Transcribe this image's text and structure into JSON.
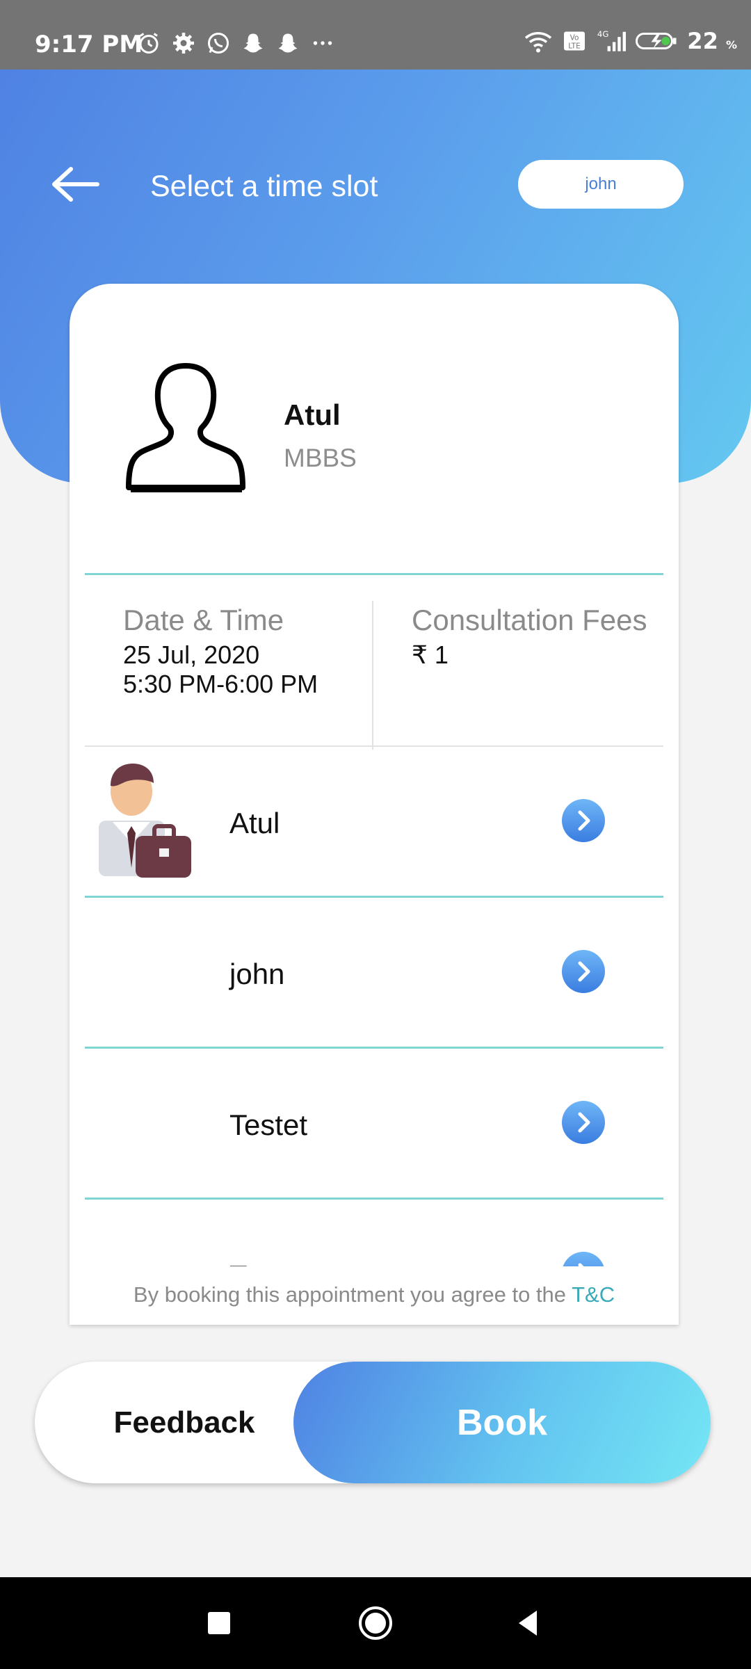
{
  "status_bar": {
    "time": "9:17 PM",
    "left_icons": [
      "alarm-icon",
      "settings-icon",
      "whatsapp-icon",
      "snapchat-icon",
      "snapchat-icon",
      "more-icon"
    ],
    "right_icons": [
      "wifi-icon",
      "volte-icon",
      "signal-4g-icon",
      "battery-charging-icon"
    ],
    "battery_percent": "22",
    "battery_unit": "%"
  },
  "header": {
    "title": "Select a time slot",
    "user_pill": "john",
    "back_icon": "back-arrow-icon"
  },
  "doctor": {
    "name": "Atul",
    "degree": "MBBS",
    "avatar_icon": "person-silhouette-icon"
  },
  "appointment": {
    "date_time_label": "Date & Time",
    "date": "25 Jul, 2020",
    "time": "5:30 PM-6:00 PM",
    "fees_label": "Consultation Fees",
    "fees_value": "₹ 1"
  },
  "patients": [
    {
      "name": "Atul",
      "has_avatar": true
    },
    {
      "name": "john",
      "has_avatar": false
    },
    {
      "name": "Testet",
      "has_avatar": false
    },
    {
      "name": "Test",
      "has_avatar": false
    }
  ],
  "terms": {
    "text": "By booking this appointment you agree to the ",
    "link": "T&C"
  },
  "actions": {
    "feedback_label": "Feedback",
    "book_label": "Book"
  },
  "colors": {
    "header_gradient_start": "#4f82e3",
    "header_gradient_end": "#64c8f0",
    "divider": "#7fd5d3",
    "link": "#3aa9b8"
  }
}
